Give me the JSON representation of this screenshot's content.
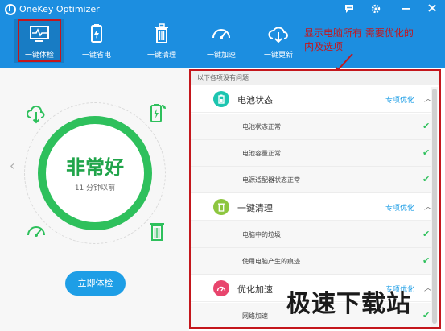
{
  "app": {
    "title": "OneKey Optimizer"
  },
  "nav": {
    "items": [
      {
        "label": "一键体检",
        "icon": "monitor-pulse-icon"
      },
      {
        "label": "一键省电",
        "icon": "battery-charge-icon"
      },
      {
        "label": "一键清理",
        "icon": "trash-icon"
      },
      {
        "label": "一键加速",
        "icon": "speedometer-icon"
      },
      {
        "label": "一键更新",
        "icon": "cloud-download-icon"
      }
    ]
  },
  "annotation": {
    "line1": "显示电脑所有 需要优化的",
    "line2": "内及选项"
  },
  "status": {
    "text": "非常好",
    "time": "11 分钟以前"
  },
  "left": {
    "check_button": "立即体检"
  },
  "right": {
    "header": "以下各项没有问题",
    "categories": [
      {
        "title": "电池状态",
        "link": "专项优化",
        "color": "#1cc5b0",
        "rows": [
          "电池状态正常",
          "电池容量正常",
          "电源适配器状态正常"
        ]
      },
      {
        "title": "一键清理",
        "link": "专项优化",
        "color": "#8dc63f",
        "rows": [
          "电脑中的垃圾",
          "使用电脑产生的痕迹"
        ]
      },
      {
        "title": "优化加速",
        "link": "专项优化",
        "color": "#e8456d",
        "rows": [
          "网络加速"
        ]
      }
    ]
  },
  "watermark": "极速下载站",
  "colors": {
    "header": "#1c8ee0",
    "accent_green": "#2ec05c",
    "highlight_red": "#c4161c"
  }
}
